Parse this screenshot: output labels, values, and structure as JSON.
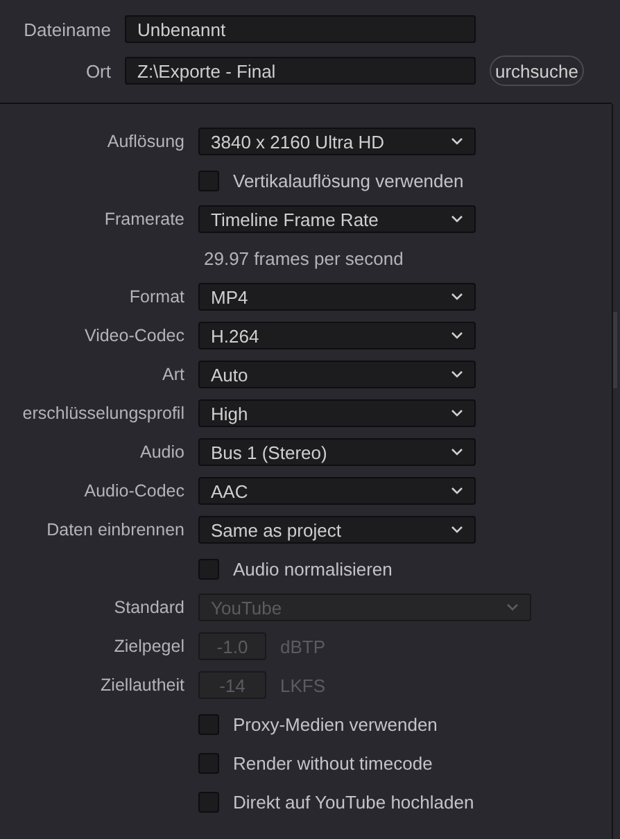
{
  "file": {
    "name_label": "Dateiname",
    "name_value": "Unbenannt",
    "location_label": "Ort",
    "location_value": "Z:\\Exporte - Final",
    "browse_button": "urchsuche"
  },
  "settings": [
    {
      "kind": "select",
      "label": "Auflösung",
      "value": "3840 x 2160 Ultra HD",
      "disabled": false
    },
    {
      "kind": "checkbox",
      "label": "Vertikalauflösung verwenden",
      "checked": false
    },
    {
      "kind": "select",
      "label": "Framerate",
      "value": "Timeline Frame Rate",
      "disabled": false
    },
    {
      "kind": "info",
      "text": "29.97 frames per second"
    },
    {
      "kind": "select",
      "label": "Format",
      "value": "MP4",
      "disabled": false
    },
    {
      "kind": "select",
      "label": "Video-Codec",
      "value": "H.264",
      "disabled": false
    },
    {
      "kind": "select",
      "label": "Art",
      "value": "Auto",
      "disabled": false
    },
    {
      "kind": "select",
      "label": "erschlüsselungsprofil",
      "value": "High",
      "disabled": false
    },
    {
      "kind": "select",
      "label": "Audio",
      "value": "Bus 1 (Stereo)",
      "disabled": false
    },
    {
      "kind": "select",
      "label": "Audio-Codec",
      "value": "AAC",
      "disabled": false
    },
    {
      "kind": "select",
      "label": "Daten einbrennen",
      "value": "Same as project",
      "disabled": false
    },
    {
      "kind": "checkbox",
      "label": "Audio normalisieren",
      "checked": false
    },
    {
      "kind": "wide-select",
      "label": "Standard",
      "value": "YouTube",
      "disabled": true
    },
    {
      "kind": "number",
      "label": "Zielpegel",
      "value": "-1.0",
      "unit": "dBTP",
      "disabled": true
    },
    {
      "kind": "number",
      "label": "Ziellautheit",
      "value": "-14",
      "unit": "LKFS",
      "disabled": true
    },
    {
      "kind": "checkbox",
      "label": "Proxy-Medien verwenden",
      "checked": false
    },
    {
      "kind": "checkbox",
      "label": "Render without timecode",
      "checked": false
    },
    {
      "kind": "checkbox",
      "label": "Direkt auf YouTube hochladen",
      "checked": false
    }
  ]
}
